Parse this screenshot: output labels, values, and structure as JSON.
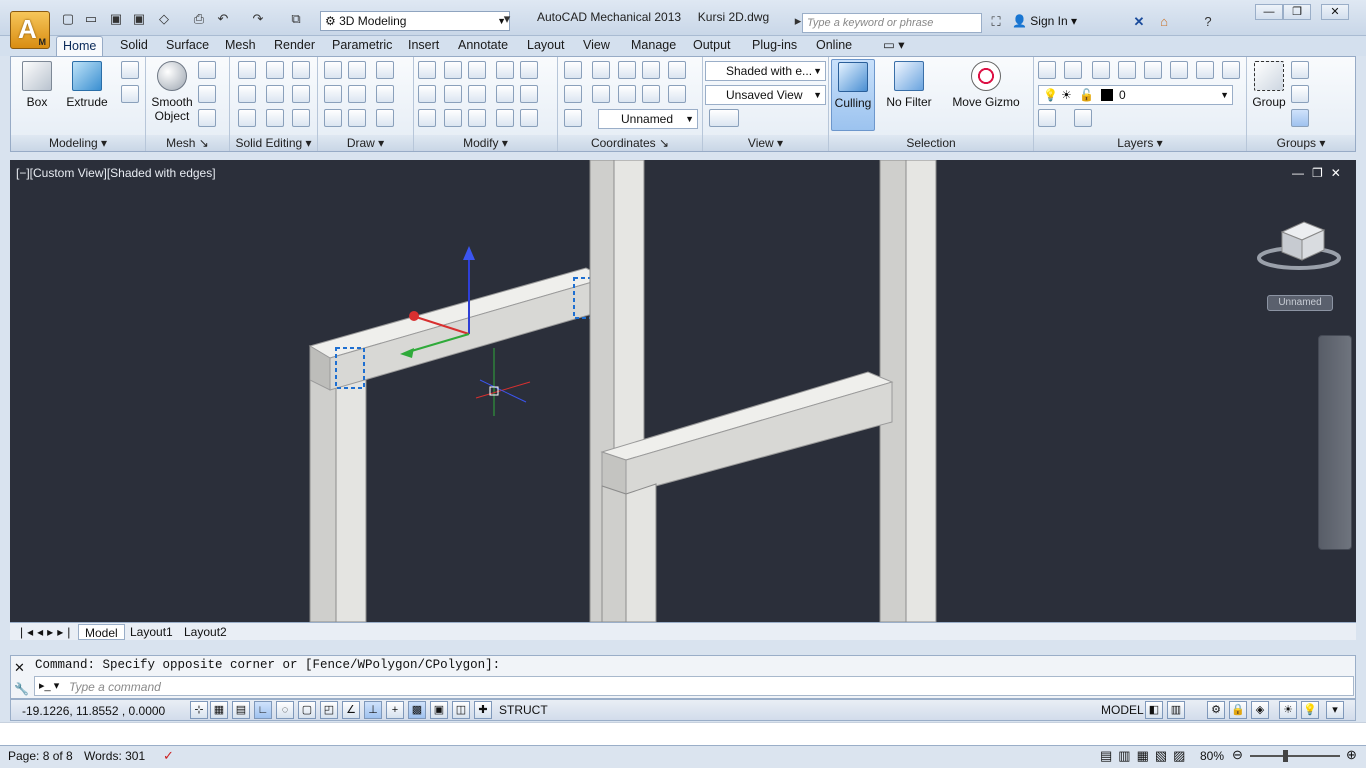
{
  "app": {
    "workspace": "3D Modeling",
    "title": "AutoCAD Mechanical 2013",
    "file": "Kursi 2D.dwg",
    "search_placeholder": "Type a keyword or phrase",
    "sign_in": "Sign In"
  },
  "tabs": [
    "Home",
    "Solid",
    "Surface",
    "Mesh",
    "Render",
    "Parametric",
    "Insert",
    "Annotate",
    "Layout",
    "View",
    "Manage",
    "Output",
    "Plug-ins",
    "Online"
  ],
  "active_tab": "Home",
  "ribbon": {
    "modeling": {
      "title": "Modeling",
      "box": "Box",
      "extrude": "Extrude"
    },
    "mesh": {
      "title": "Mesh",
      "smooth_object_1": "Smooth",
      "smooth_object_2": "Object"
    },
    "solid_editing": {
      "title": "Solid Editing"
    },
    "draw": {
      "title": "Draw"
    },
    "modify": {
      "title": "Modify"
    },
    "coordinates": {
      "title": "Coordinates",
      "ucs_name": "Unnamed"
    },
    "view": {
      "title": "View",
      "visual_style": "Shaded with e...",
      "saved_view": "Unsaved View"
    },
    "selection": {
      "title": "Selection",
      "culling": "Culling",
      "no_filter": "No Filter",
      "move_gizmo": "Move Gizmo"
    },
    "layers": {
      "title": "Layers",
      "current_layer": "0"
    },
    "groups": {
      "title": "Groups",
      "group": "Group"
    }
  },
  "viewport": {
    "label": "[−][Custom View][Shaded with edges]",
    "ucs_name": "Unnamed"
  },
  "layout_tabs": [
    "Model",
    "Layout1",
    "Layout2"
  ],
  "command": {
    "history": "Command: Specify opposite corner or [Fence/WPolygon/CPolygon]:",
    "placeholder": "Type a command"
  },
  "status": {
    "coords": "-19.1226, 11.8552 , 0.0000",
    "struct": "STRUCT",
    "model": "MODEL"
  },
  "word_status": {
    "page": "Page: 8 of 8",
    "words": "Words: 301",
    "zoom": "80%"
  }
}
